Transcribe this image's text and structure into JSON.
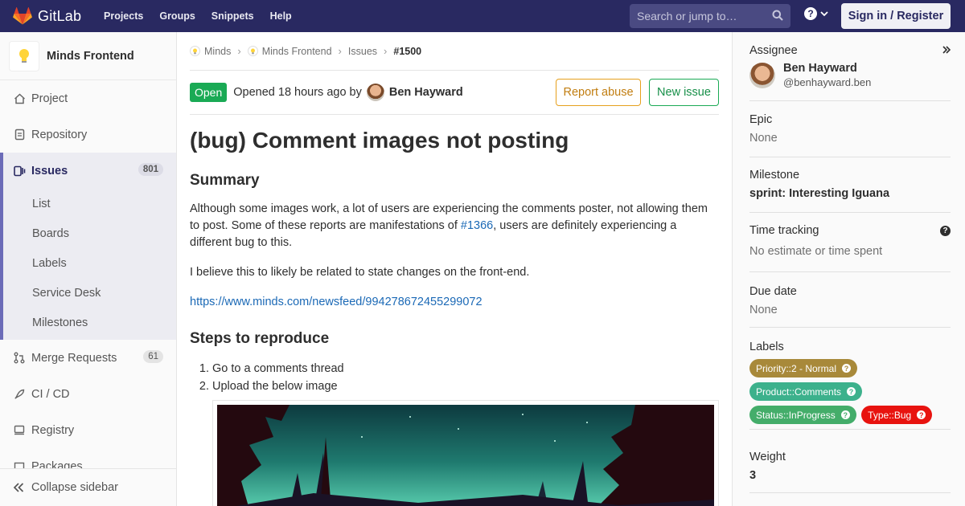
{
  "navbar": {
    "brand": "GitLab",
    "links": [
      "Projects",
      "Groups",
      "Snippets",
      "Help"
    ],
    "search_placeholder": "Search or jump to…",
    "sign_in": "Sign in / Register",
    "help_glyph": "?",
    "chevron_glyph": "⌄"
  },
  "sidebar": {
    "project_name": "Minds Frontend",
    "items": [
      {
        "label": "Project",
        "icon": "home-icon"
      },
      {
        "label": "Repository",
        "icon": "file-icon"
      },
      {
        "label": "Issues",
        "icon": "issues-icon",
        "count": "801"
      },
      {
        "label": "Merge Requests",
        "icon": "merge-request-icon",
        "count": "61"
      },
      {
        "label": "CI / CD",
        "icon": "rocket-icon"
      },
      {
        "label": "Registry",
        "icon": "container-icon"
      },
      {
        "label": "Packages",
        "icon": "package-icon"
      }
    ],
    "issue_subitems": [
      "List",
      "Boards",
      "Labels",
      "Service Desk",
      "Milestones"
    ],
    "collapse_label": "Collapse sidebar"
  },
  "breadcrumb": {
    "items": [
      "Minds",
      "Minds Frontend",
      "Issues",
      "#1500"
    ]
  },
  "issue": {
    "status": "Open",
    "opened_text": "Opened 18 hours ago by",
    "author": "Ben Hayward",
    "report_abuse": "Report abuse",
    "new_issue": "New issue",
    "title": "(bug) Comment images not posting",
    "summary_heading": "Summary",
    "summary_p1_a": "Although some images work, a lot of users are experiencing the comments poster, not allowing them to post. Some of these reports are manifestations of ",
    "summary_p1_link": "#1366",
    "summary_p1_b": ", users are definitely experiencing a different bug to this.",
    "summary_p2": "I believe this to likely be related to state changes on the front-end.",
    "summary_link": "https://www.minds.com/newsfeed/994278672455299072",
    "steps_heading": "Steps to reproduce",
    "steps": [
      "Go to a comments thread",
      "Upload the below image"
    ]
  },
  "right_sidebar": {
    "assignee_title": "Assignee",
    "assignee_name": "Ben Hayward",
    "assignee_username": "@benhayward.ben",
    "epic_title": "Epic",
    "epic_value": "None",
    "milestone_title": "Milestone",
    "milestone_value": "sprint: Interesting Iguana",
    "time_title": "Time tracking",
    "time_value": "No estimate or time spent",
    "due_title": "Due date",
    "due_value": "None",
    "labels_title": "Labels",
    "labels": [
      {
        "text": "Priority::2 - Normal",
        "color": "#a8893a",
        "icon_color": "#a8893a"
      },
      {
        "text": "Product::Comments",
        "color": "#3cb18c",
        "icon_color": "#3cb18c"
      },
      {
        "text": "Status::InProgress",
        "color": "#44ad6a",
        "icon_color": "#44ad6a"
      },
      {
        "text": "Type::Bug",
        "color": "#e8130f",
        "icon_color": "#e8130f"
      }
    ],
    "weight_title": "Weight",
    "weight_value": "3",
    "help_glyph": "?",
    "label_help_glyph": "?"
  },
  "colors": {
    "navbar": "#292961",
    "open": "#1aaa55",
    "link": "#1b69b6",
    "abuse": "#e6a01d"
  }
}
